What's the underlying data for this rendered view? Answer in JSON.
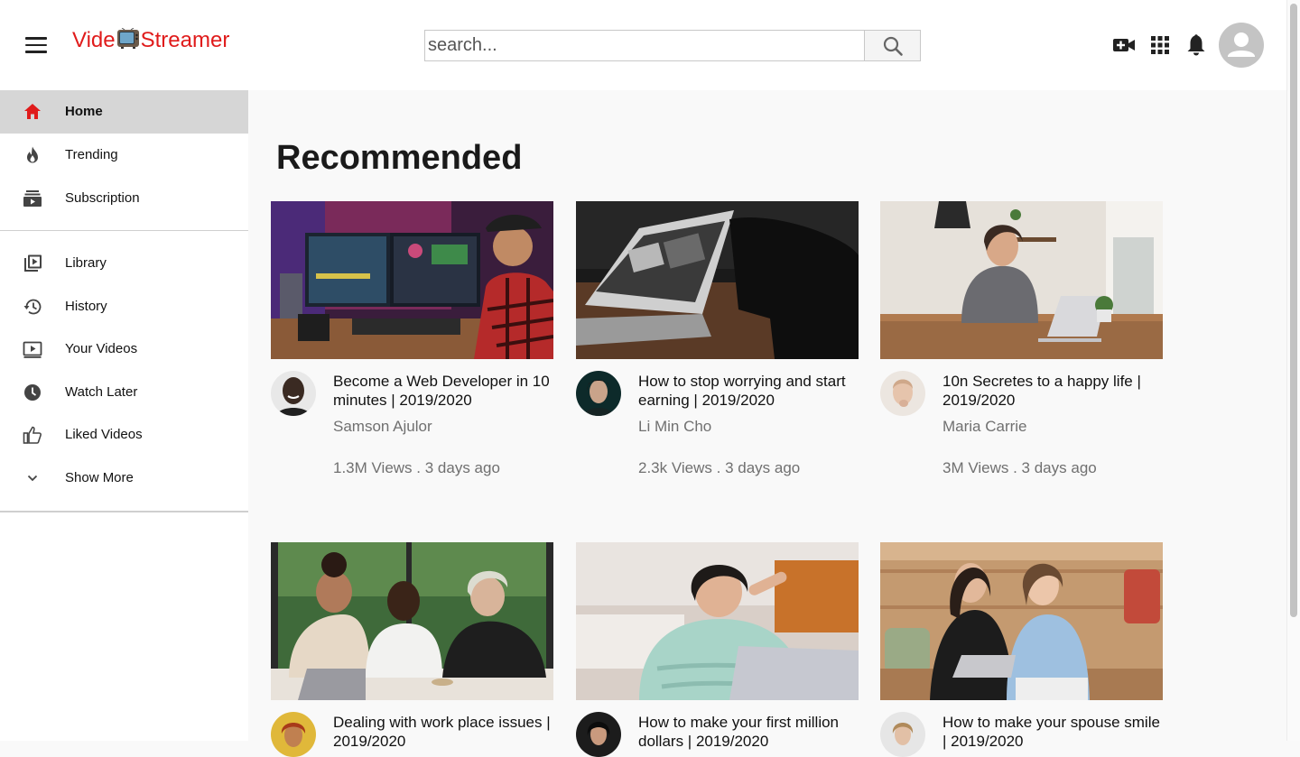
{
  "header": {
    "logo_left": "Vide",
    "logo_right": "Streamer",
    "search_placeholder": "search...",
    "icons": [
      "menu-icon",
      "tv-icon",
      "search-icon",
      "video-camera-plus-icon",
      "apps-grid-icon",
      "bell-icon",
      "user-avatar-icon"
    ]
  },
  "sidebar": {
    "items": [
      {
        "label": "Home",
        "icon": "home-icon",
        "active": true
      },
      {
        "label": "Trending",
        "icon": "fire-icon"
      },
      {
        "label": "Subscription",
        "icon": "subscriptions-icon"
      },
      {
        "label": "Library",
        "icon": "library-icon"
      },
      {
        "label": "History",
        "icon": "history-icon"
      },
      {
        "label": "Your Videos",
        "icon": "your-videos-icon"
      },
      {
        "label": "Watch Later",
        "icon": "clock-icon"
      },
      {
        "label": "Liked Videos",
        "icon": "thumbs-up-icon"
      },
      {
        "label": "Show More",
        "icon": "chevron-down-icon"
      }
    ]
  },
  "main": {
    "title": "Recommended",
    "videos": [
      {
        "title": "Become a Web Developer in 10 minutes | 2019/2020",
        "channel": "Samson Ajulor",
        "meta": "1.3M Views . 3 days ago"
      },
      {
        "title": "How to stop worrying and start earning | 2019/2020",
        "channel": "Li Min Cho",
        "meta": "2.3k Views . 3 days ago"
      },
      {
        "title": "10n Secretes to a happy life | 2019/2020",
        "channel": "Maria Carrie",
        "meta": "3M Views . 3 days ago"
      },
      {
        "title": "Dealing with work place issues | 2019/2020",
        "channel": "",
        "meta": ""
      },
      {
        "title": "How to make your first million dollars | 2019/2020",
        "channel": "",
        "meta": ""
      },
      {
        "title": "How to make your spouse smile | 2019/2020",
        "channel": "",
        "meta": ""
      }
    ]
  },
  "colors": {
    "brand": "#e01b1b",
    "active_item_bg": "#d6d6d6",
    "page_bg": "#f9f9f9",
    "meta_text": "#707070"
  }
}
